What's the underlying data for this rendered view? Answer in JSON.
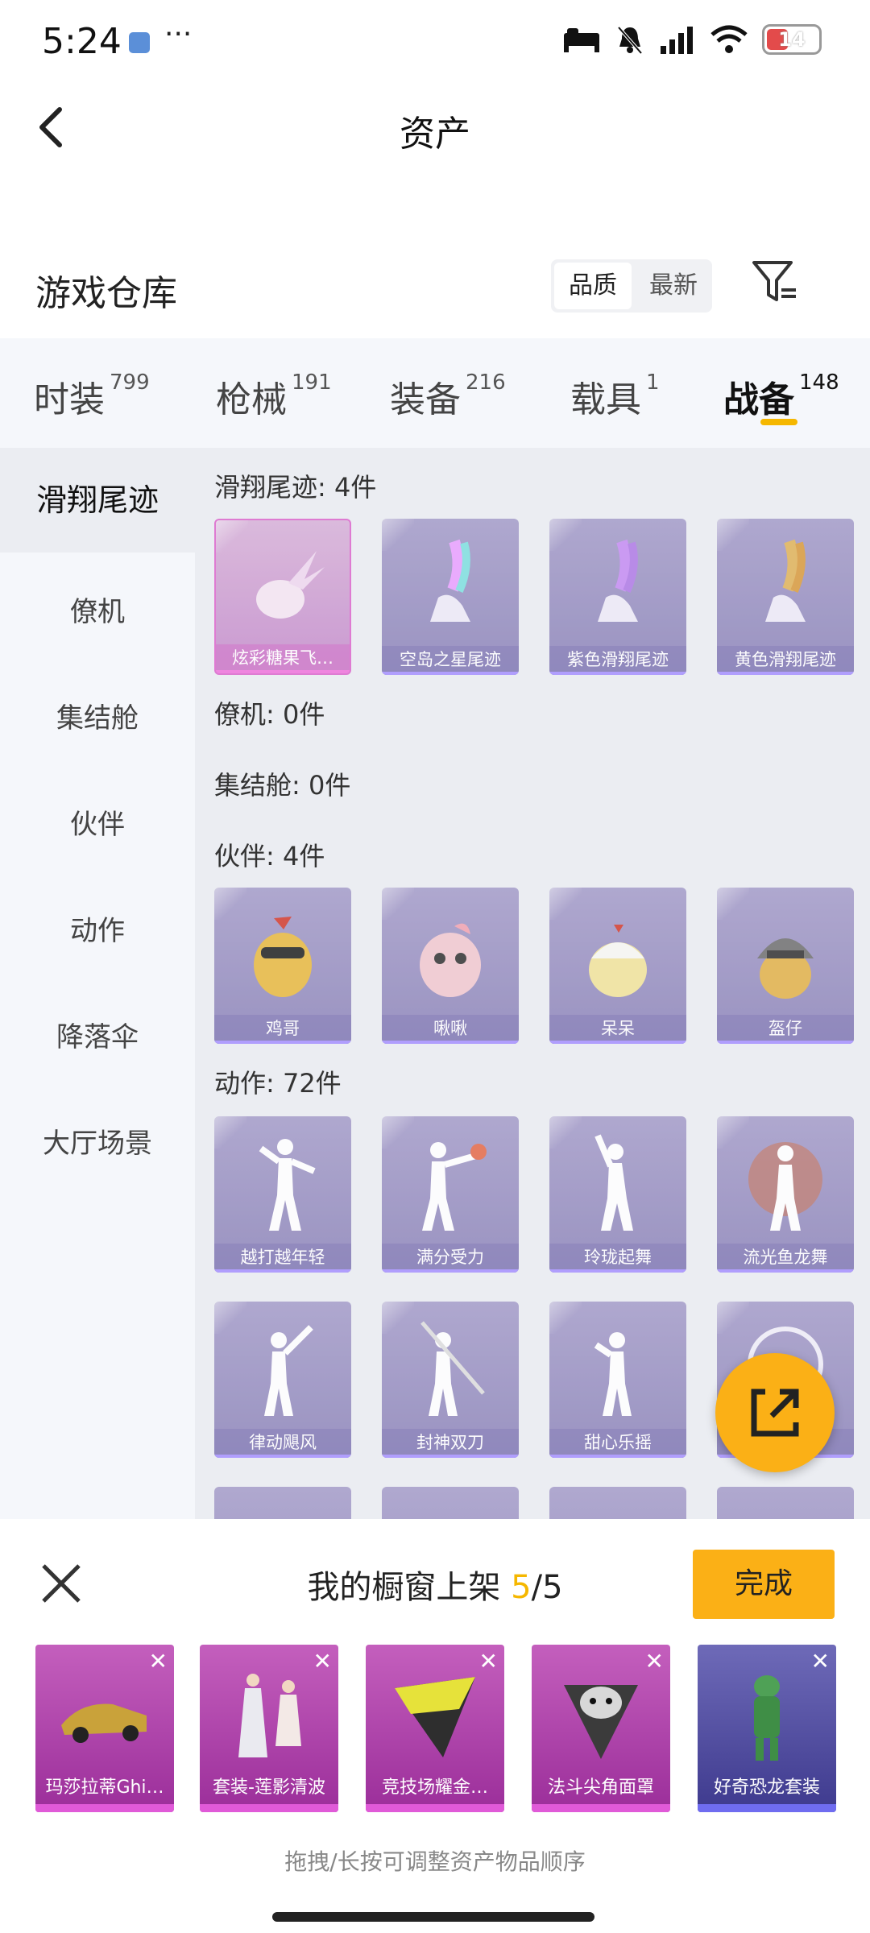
{
  "status_bar": {
    "time": "5:24",
    "dots": "···",
    "battery": "14"
  },
  "header": {
    "title": "资产"
  },
  "warehouse": {
    "title": "游戏仓库",
    "sort_quality": "品质",
    "sort_newest": "最新"
  },
  "tabs": [
    {
      "label": "时装",
      "count": "799"
    },
    {
      "label": "枪械",
      "count": "191"
    },
    {
      "label": "装备",
      "count": "216"
    },
    {
      "label": "载具",
      "count": "1"
    },
    {
      "label": "战备",
      "count": "148"
    }
  ],
  "sidebar": {
    "items": [
      {
        "label": "滑翔尾迹"
      },
      {
        "label": "僚机"
      },
      {
        "label": "集结舱"
      },
      {
        "label": "伙伴"
      },
      {
        "label": "动作"
      },
      {
        "label": "降落伞"
      },
      {
        "label": "大厅场景"
      }
    ]
  },
  "content": {
    "sections": [
      {
        "title": "滑翔尾迹: 4件",
        "items": [
          "炫彩糖果飞…",
          "空岛之星尾迹",
          "紫色滑翔尾迹",
          "黄色滑翔尾迹"
        ]
      },
      {
        "title": "僚机: 0件"
      },
      {
        "title": "集结舱: 0件"
      },
      {
        "title": "伙伴: 4件",
        "items": [
          "鸡哥",
          "啾啾",
          "呆呆",
          "盔仔"
        ]
      },
      {
        "title": "动作: 72件",
        "items": [
          "越打越年轻",
          "满分受力",
          "玲珑起舞",
          "流光鱼龙舞",
          "律动飓风",
          "封神双刀",
          "甜心乐摇",
          ""
        ]
      }
    ]
  },
  "sheet": {
    "title_prefix": "我的橱窗上架 ",
    "current": "5",
    "total": "/5",
    "done_label": "完成",
    "slots": [
      "玛莎拉蒂Ghi…",
      "套装-莲影清波",
      "竞技场耀金…",
      "法斗尖角面罩",
      "好奇恐龙套装"
    ],
    "hint": "拖拽/长按可调整资产物品顺序"
  },
  "colors": {
    "accent": "#fbb016",
    "underline": "#f5b700",
    "card_purple": "#9b93c4",
    "card_pink": "#d7a6d6"
  }
}
